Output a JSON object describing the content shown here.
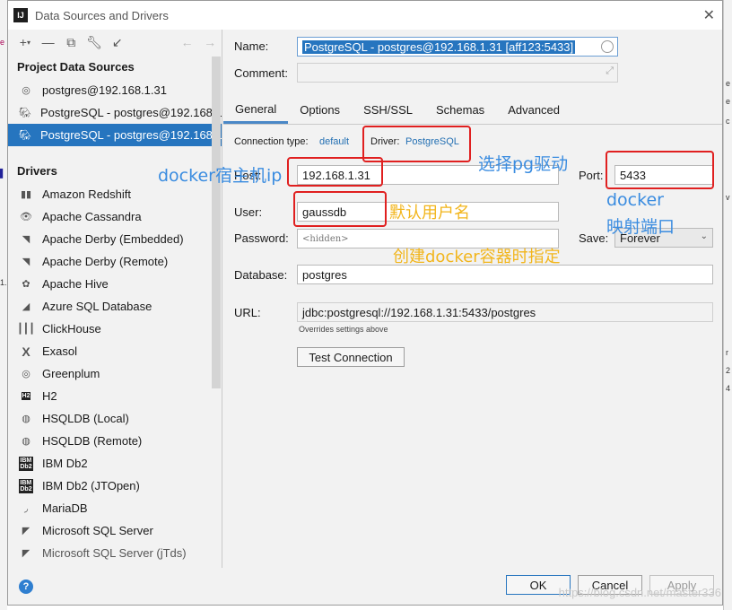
{
  "window": {
    "title": "Data Sources and Drivers",
    "app_icon": "IJ"
  },
  "toolbar": {
    "icons": [
      "add-icon",
      "remove-icon",
      "duplicate-icon",
      "wrench-icon",
      "import-icon",
      "back-arrow-icon",
      "forward-arrow-icon"
    ]
  },
  "project_sources": {
    "heading": "Project Data Sources",
    "items": [
      {
        "label": "postgres@192.168.1.31",
        "icon": "postgres-icon"
      },
      {
        "label": "PostgreSQL - postgres@192.168.1",
        "icon": "elephant-icon"
      },
      {
        "label": "PostgreSQL - postgres@192.168.1",
        "icon": "elephant-icon",
        "selected": true
      }
    ]
  },
  "drivers": {
    "heading": "Drivers",
    "items": [
      "Amazon Redshift",
      "Apache Cassandra",
      "Apache Derby (Embedded)",
      "Apache Derby (Remote)",
      "Apache Hive",
      "Azure SQL Database",
      "ClickHouse",
      "Exasol",
      "Greenplum",
      "H2",
      "HSQLDB (Local)",
      "HSQLDB (Remote)",
      "IBM Db2",
      "IBM Db2 (JTOpen)",
      "MariaDB",
      "Microsoft SQL Server",
      "Microsoft SQL Server (jTds)"
    ]
  },
  "form": {
    "name_label": "Name:",
    "name_value": "PostgreSQL - postgres@192.168.1.31 [aff123:5433]",
    "comment_label": "Comment:",
    "tabs": [
      "General",
      "Options",
      "SSH/SSL",
      "Schemas",
      "Advanced"
    ],
    "connection_type_label": "Connection type:",
    "connection_type_value": "default",
    "driver_label": "Driver:",
    "driver_value": "PostgreSQL",
    "host_label": "Host:",
    "host_value": "192.168.1.31",
    "port_label": "Port:",
    "port_value": "5433",
    "user_label": "User:",
    "user_value": "gaussdb",
    "password_label": "Password:",
    "password_placeholder": "<hidden>",
    "save_label": "Save:",
    "save_value": "Forever",
    "database_label": "Database:",
    "database_value": "postgres",
    "url_label": "URL:",
    "url_value": "jdbc:postgresql://192.168.1.31:5433/postgres",
    "url_note": "Overrides settings above",
    "test_connection": "Test Connection"
  },
  "footer": {
    "ok": "OK",
    "cancel": "Cancel",
    "apply": "Apply"
  },
  "annotations": {
    "driver_note": "选择pg驱动",
    "host_note": "docker宿主机ip",
    "port_note_1": "docker",
    "port_note_2": "映射端口",
    "user_note": "默认用户名",
    "container_note": "创建docker容器时指定"
  },
  "watermark": "https://blog.csdn.net/master336",
  "colors": {
    "selection": "#2675bf",
    "annotation_red": "#e02020",
    "annotation_blue": "#3a8ce0",
    "annotation_yellow": "#f2b51b",
    "link": "#2470b3"
  }
}
